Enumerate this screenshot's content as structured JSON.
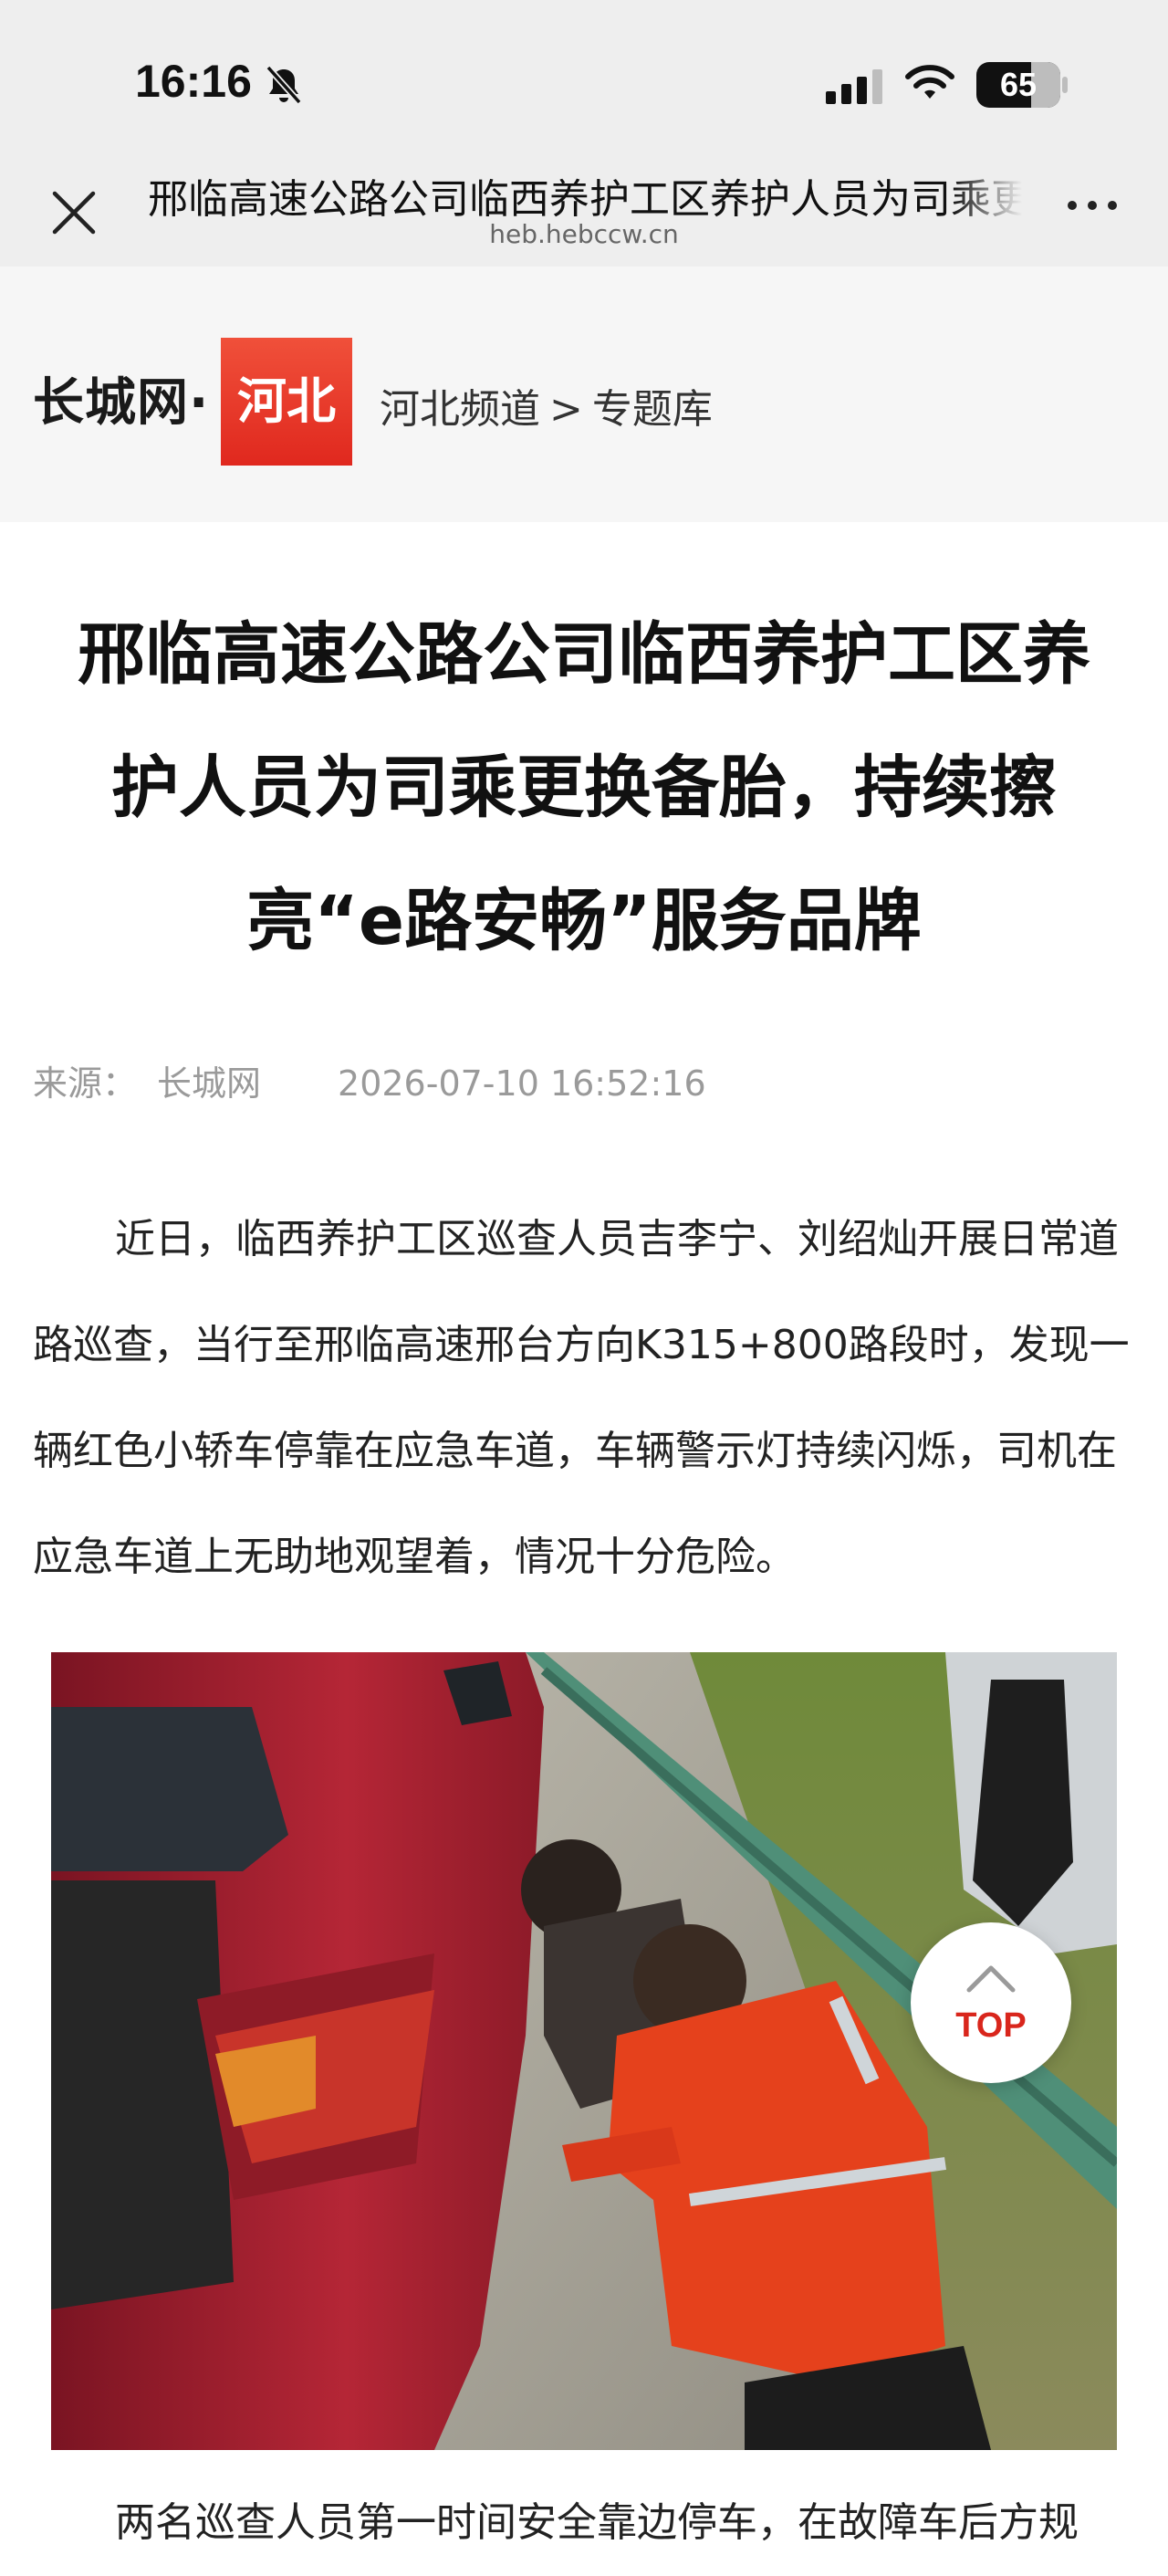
{
  "status_bar": {
    "time": "16:16",
    "battery": "65",
    "battery_level": 0.65
  },
  "browser": {
    "title": "邢临高速公路公司临西养护工区养护人员为司乘更换备胎，持续擦亮“e路安畅”服务品牌",
    "url": "heb.hebccw.cn"
  },
  "site": {
    "logo_text": "长城网·",
    "logo_badge": "河北",
    "breadcrumb": [
      "河北频道",
      ">",
      "专题库"
    ]
  },
  "article": {
    "title": "邢临高速公路公司临西养护工区养护人员为司乘更换备胎，持续擦亮“e路安畅”服务品牌",
    "source_label": "来源：",
    "source": "长城网",
    "date": "2026-07-10 16:52:16",
    "paragraph1": "近日，临西养护工区巡查人员吉李宁、刘绍灿开展日常道路巡查，当行至邢临高速邢台方向K315+800路段时，发现一辆红色小轿车停靠在应急车道，车辆警示灯持续闪烁，司机在应急车道上无助地观望着，情况十分危险。",
    "paragraph2": "两名巡查人员第一时间安全靠边停车，在故障车后方规"
  },
  "back_to_top": {
    "label": "TOP"
  },
  "colors": {
    "brand_red": "#e0281e",
    "top_label": "#d9261c",
    "bar_gray": "#eeeeee"
  },
  "icons": [
    "bell-slash-icon",
    "signal-icon",
    "wifi-icon",
    "battery-icon",
    "close-icon",
    "more-icon",
    "chevron-up-icon"
  ]
}
